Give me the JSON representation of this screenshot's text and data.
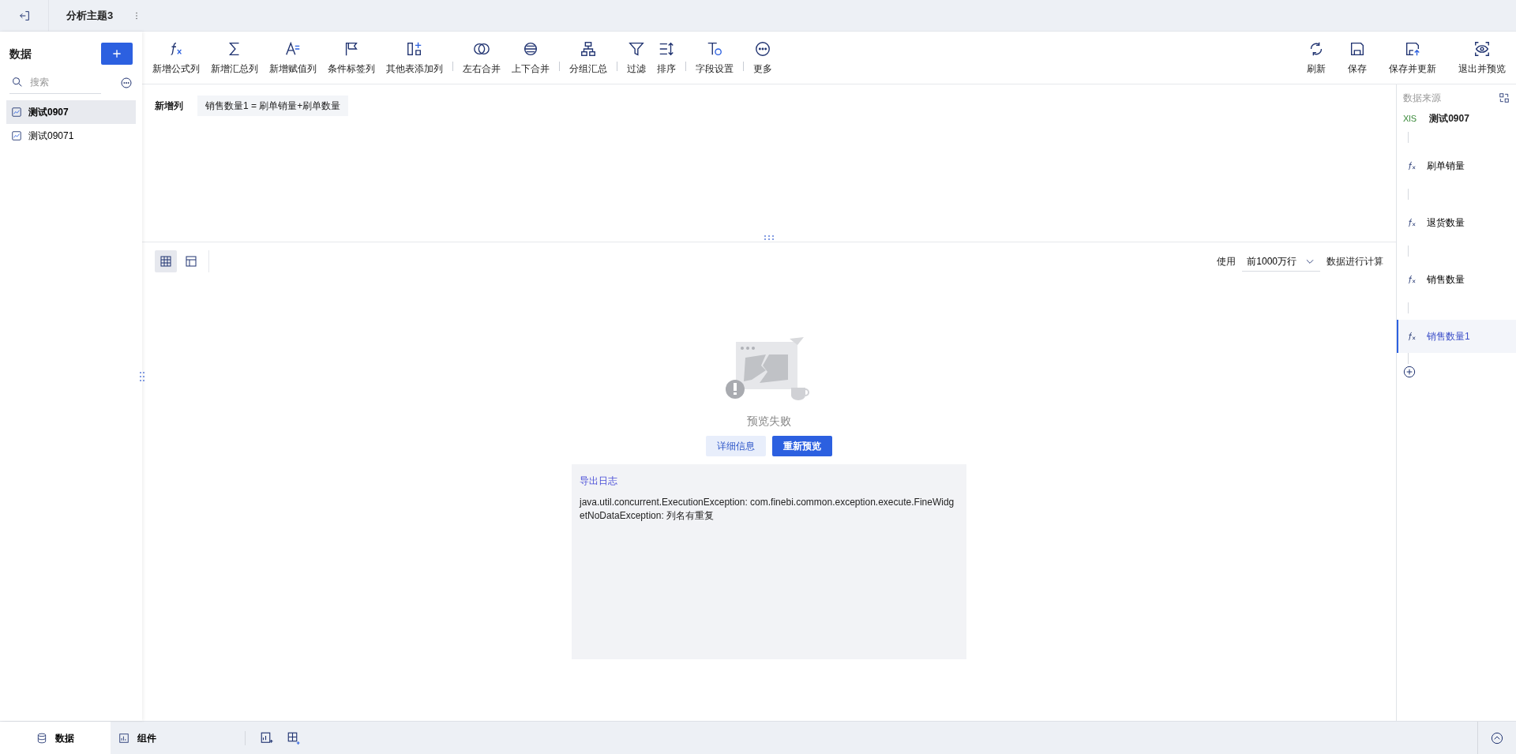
{
  "header": {
    "title": "分析主题3"
  },
  "sidebar": {
    "title": "数据",
    "search": {
      "placeholder": "搜索"
    },
    "items": [
      {
        "label": "测试0907",
        "selected": true
      },
      {
        "label": "测试09071",
        "selected": false
      }
    ]
  },
  "toolbar": {
    "groups": [
      [
        {
          "kind": "formula",
          "label": "新增公式列"
        },
        {
          "kind": "sum",
          "label": "新增汇总列"
        },
        {
          "kind": "assign",
          "label": "新增赋值列"
        },
        {
          "kind": "tag",
          "label": "条件标签列"
        },
        {
          "kind": "addcol",
          "label": "其他表添加列"
        }
      ],
      [
        {
          "kind": "join-lr",
          "label": "左右合并"
        },
        {
          "kind": "join-ud",
          "label": "上下合并"
        }
      ],
      [
        {
          "kind": "group",
          "label": "分组汇总"
        }
      ],
      [
        {
          "kind": "filter",
          "label": "过滤"
        },
        {
          "kind": "sort",
          "label": "排序"
        }
      ],
      [
        {
          "kind": "field",
          "label": "字段设置"
        }
      ],
      [
        {
          "kind": "more",
          "label": "更多"
        }
      ]
    ],
    "actions": [
      {
        "kind": "refresh",
        "label": "刷新"
      },
      {
        "kind": "save",
        "label": "保存"
      },
      {
        "kind": "save-update",
        "label": "保存并更新"
      },
      {
        "kind": "exit-preview",
        "label": "退出并预览"
      }
    ]
  },
  "formula": {
    "label": "新增列",
    "expression": "销售数量1 = 刷单销量+刷单数量"
  },
  "preview": {
    "views": [
      {
        "kind": "table",
        "selected": true
      },
      {
        "kind": "layout",
        "selected": false
      }
    ],
    "use_label": "使用",
    "row_limit": "前1000万行",
    "compute_label": "数据进行计算",
    "error": {
      "message": "预览失败",
      "details_button": "详细信息",
      "retry_button": "重新预览",
      "log_link": "导出日志",
      "log_text": "java.util.concurrent.ExecutionException: com.finebi.common.exception.execute.FineWidgetNoDataException: 列名有重复"
    }
  },
  "lineage": {
    "title": "数据来源",
    "source": {
      "file_type": "XlS",
      "label": "测试0907"
    },
    "steps": [
      {
        "label": "刷单销量",
        "selected": false
      },
      {
        "label": "退货数量",
        "selected": false
      },
      {
        "label": "销售数量",
        "selected": false
      },
      {
        "label": "销售数量1",
        "selected": true
      }
    ]
  },
  "bottom_tabs": [
    {
      "kind": "data",
      "label": "数据",
      "selected": true
    },
    {
      "kind": "component",
      "label": "组件",
      "selected": false
    }
  ]
}
